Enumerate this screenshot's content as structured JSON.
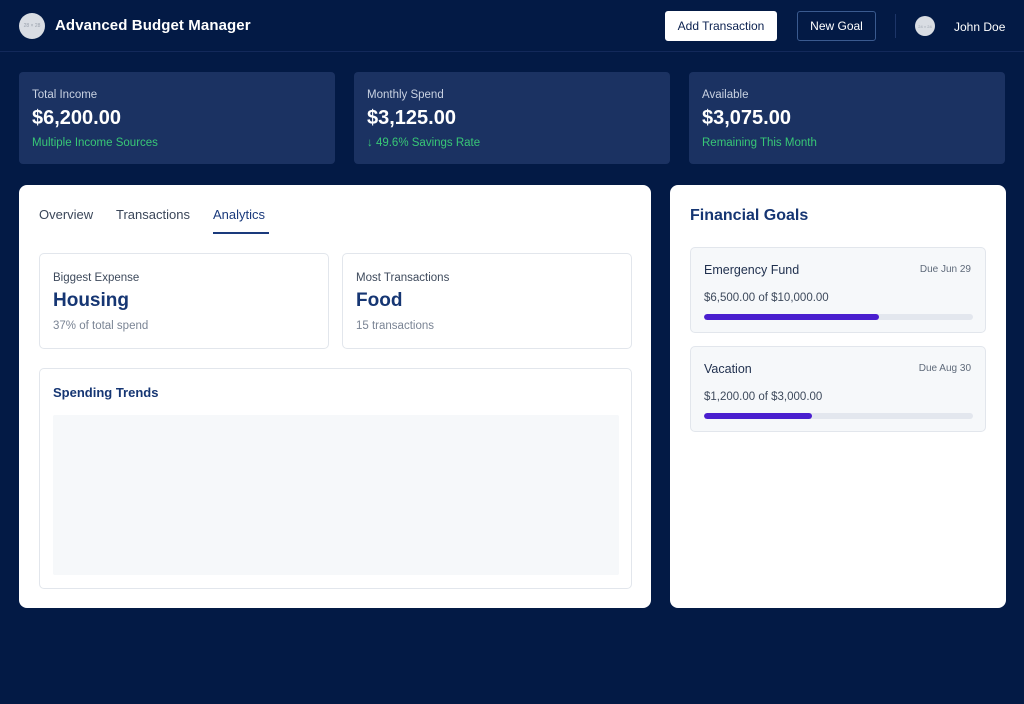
{
  "header": {
    "logo_text": "28 × 28",
    "title": "Advanced Budget Manager",
    "add_transaction_label": "Add Transaction",
    "new_goal_label": "New Goal",
    "avatar_text": "24 × 24",
    "user_name": "John Doe"
  },
  "stats": [
    {
      "label": "Total Income",
      "value": "$6,200.00",
      "sub": "Multiple Income Sources"
    },
    {
      "label": "Monthly Spend",
      "value": "$3,125.00",
      "sub": "↓ 49.6% Savings Rate"
    },
    {
      "label": "Available",
      "value": "$3,075.00",
      "sub": "Remaining This Month"
    }
  ],
  "tabs": [
    {
      "label": "Overview",
      "active": false
    },
    {
      "label": "Transactions",
      "active": false
    },
    {
      "label": "Analytics",
      "active": true
    }
  ],
  "analytics": {
    "biggest_expense": {
      "label": "Biggest Expense",
      "value": "Housing",
      "sub": "37% of total spend"
    },
    "most_transactions": {
      "label": "Most Transactions",
      "value": "Food",
      "sub": "15 transactions"
    },
    "trends_title": "Spending Trends"
  },
  "goals": {
    "title": "Financial Goals",
    "items": [
      {
        "name": "Emergency Fund",
        "due": "Due Jun 29",
        "amount": "$6,500.00 of $10,000.00",
        "progress": 0.65
      },
      {
        "name": "Vacation",
        "due": "Due Aug 30",
        "amount": "$1,200.00 of $3,000.00",
        "progress": 0.4
      }
    ]
  },
  "colors": {
    "background": "#031a45",
    "card": "#1b3262",
    "positive": "#38c776",
    "accent": "#163673",
    "progress": "#4a1fcf"
  }
}
